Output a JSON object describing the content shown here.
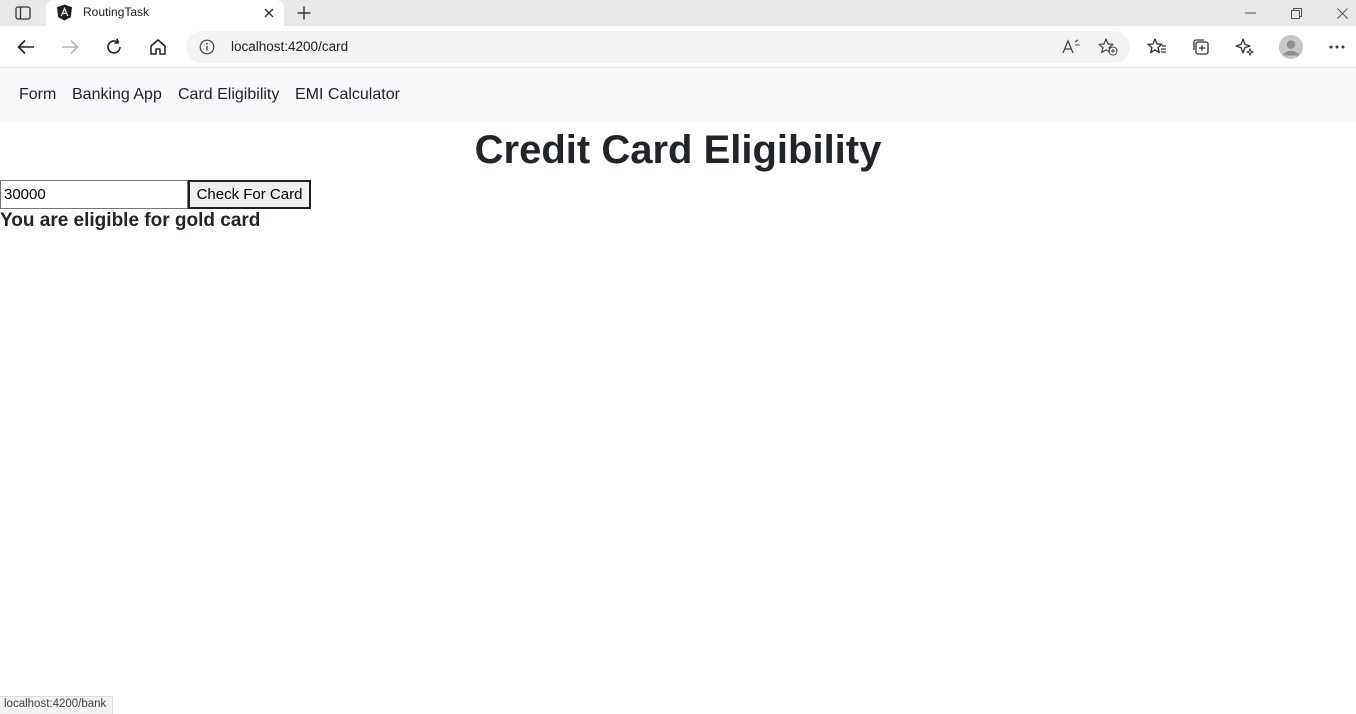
{
  "browser": {
    "tab": {
      "title": "RoutingTask"
    },
    "address_bar": {
      "url": "localhost:4200/card"
    },
    "status_bar": {
      "url": "localhost:4200/bank"
    }
  },
  "navbar": {
    "links": [
      {
        "label": "Form"
      },
      {
        "label": "Banking App"
      },
      {
        "label": "Card Eligibility"
      },
      {
        "label": "EMI Calculator"
      }
    ]
  },
  "page": {
    "title": "Credit Card Eligibility",
    "income_input": {
      "value": "30000"
    },
    "check_button": {
      "label": "Check For Card"
    },
    "result_text": "You are eligible for gold card"
  },
  "icons": {
    "tab_actions": "tab-actions-icon",
    "favicon": "angular-logo-icon",
    "tab_close": "close-icon",
    "new_tab": "plus-icon",
    "minimize": "minimize-icon",
    "restore": "restore-icon",
    "window_close": "close-icon",
    "back": "back-arrow-icon",
    "forward": "forward-arrow-icon",
    "refresh": "refresh-icon",
    "home": "home-icon",
    "site_info": "info-icon",
    "read_aloud": "read-aloud-icon",
    "add_favorite": "star-plus-icon",
    "favorites": "favorites-icon",
    "collections": "collections-icon",
    "copilot": "copilot-icon",
    "profile": "avatar-icon",
    "menu": "more-icon"
  }
}
